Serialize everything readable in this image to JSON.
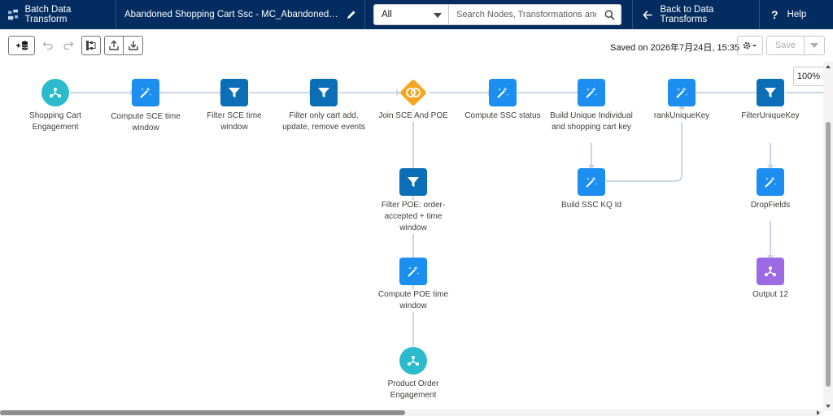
{
  "header": {
    "app_title": "Batch Data Transform",
    "doc_title": "Abandoned Shopping Cart Ssc - MC_AbandonedShopping...",
    "scope_value": "All",
    "search_placeholder": "Search Nodes, Transformations and Col",
    "back_label": "Back to Data Transforms",
    "help_label": "Help"
  },
  "toolbar": {
    "saved_text": "Saved on 2026年7月24日, 15:35",
    "save_label": "Save"
  },
  "canvas": {
    "zoom": "100%",
    "nodes": [
      {
        "id": "n1",
        "type": "input",
        "icon": "input-node-icon",
        "label": "Shopping Cart Engagement"
      },
      {
        "id": "n2",
        "type": "compute",
        "icon": "magic-wand-icon",
        "label": "Compute SCE time window"
      },
      {
        "id": "n3",
        "type": "filter",
        "icon": "filter-icon",
        "label": "Filter SCE time window"
      },
      {
        "id": "n4",
        "type": "filter",
        "icon": "filter-icon",
        "label": "Filter only cart add, update, remove events"
      },
      {
        "id": "n5",
        "type": "join",
        "icon": "join-icon",
        "label": "Join SCE And POE"
      },
      {
        "id": "n6",
        "type": "compute",
        "icon": "magic-wand-icon",
        "label": "Compute SSC status"
      },
      {
        "id": "n7",
        "type": "compute",
        "icon": "magic-wand-icon",
        "label": "Build Unique Individual and shopping cart key"
      },
      {
        "id": "n8",
        "type": "compute",
        "icon": "magic-wand-icon",
        "label": "rankUniqueKey"
      },
      {
        "id": "n9",
        "type": "filter",
        "icon": "filter-icon",
        "label": "FilterUniqueKey"
      },
      {
        "id": "n10",
        "type": "filter",
        "icon": "filter-icon",
        "label": "Filter POE: order-accepted + time window"
      },
      {
        "id": "n11",
        "type": "compute",
        "icon": "magic-wand-icon",
        "label": "Compute POE time window"
      },
      {
        "id": "n12",
        "type": "input",
        "icon": "input-node-icon",
        "label": "Product Order Engagement"
      },
      {
        "id": "n13",
        "type": "compute",
        "icon": "magic-wand-icon",
        "label": "Build SSC KQ Id"
      },
      {
        "id": "n14",
        "type": "compute",
        "icon": "magic-wand-icon",
        "label": "DropFields"
      },
      {
        "id": "n15",
        "type": "output",
        "icon": "output-node-icon",
        "label": "Output 12"
      }
    ]
  },
  "colors": {
    "header_bg": "#032d60",
    "input_node": "#2bbbcc",
    "compute_node": "#1b8ef0",
    "filter_node": "#0b6fb8",
    "join_node": "#f5a623",
    "output_node": "#9c6be3",
    "edge": "#c9d7e6"
  }
}
